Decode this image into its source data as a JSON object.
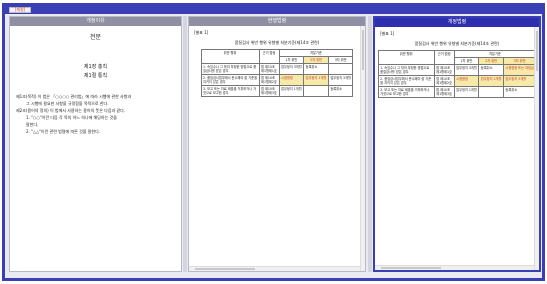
{
  "app": {
    "tab_label": "[개정]"
  },
  "panes": [
    {
      "header": "개정이유"
    },
    {
      "header": "현행법령"
    },
    {
      "header": "개정법령"
    }
  ],
  "doc": {
    "title": "전문",
    "part": "제1장 총칙",
    "chapter": "제1절 통칙",
    "lines": [
      "제1조(목적) 이 법은 「○○○○ 관리법」에 따라 시행에 관한 사항과",
      "그 시행에 필요한 사항을 규정함을 목적으로 한다.",
      "제2조(용어의 정의) 이 법에서 사용하는 용어의 뜻은 다음과 같다.",
      "1. \"○○\"이란 다음 각 목의 어느 하나에 해당하는 것을",
      "말한다.",
      "2. \"△△\"이란 관련 법령에 따른 것을 말한다."
    ]
  },
  "form": {
    "note": "[별표 1]",
    "title": "품질검사 위반 행위 유형별 처분기준(제14조 관련)",
    "col_headers": [
      "위반 행위",
      "근거 법령",
      "처분기준",
      "1차 위반",
      "2차 위반",
      "3차 위반"
    ],
    "current_rows": [
      {
        "act": "1. 속임수나 그 밖의 부정한 방법으로 품질검사를 받은 경우",
        "law": "법 제10조 제1항제1호",
        "c1": "업무정지 3개월",
        "c2": "등록취소",
        "c3": "",
        "hl": false
      },
      {
        "act": "2. 품질검사업무에서 준수해야 할 기준을 지키지 않은 경우",
        "law": "법 제10조 제1항제2호",
        "c1": "시정명령",
        "c2": "업무정지 1개월",
        "c3": "업무정지 3개월",
        "hl": true
      },
      {
        "act": "3. 보고 또는 자료 제출을 거부하거나 거짓으로 보고한 경우",
        "law": "법 제10조 제1항제3호",
        "c1": "업무정지 1개월",
        "c2": "",
        "c3": "등록취소",
        "hl": false
      }
    ],
    "revised_rows": [
      {
        "act": "1. 속임수나 그 밖의 부정한 방법으로 품질검사를 받은 경우",
        "law": "법 제10조 제1항제1호",
        "c1": "업무정지 3개월",
        "c2": "등록취소",
        "c3": "시정명령 또는 과징금",
        "hl": true
      },
      {
        "act": "2. 품질검사업무에서 준수해야 할 기준을 지키지 않은 경우",
        "law": "법 제10조 제1항제2호",
        "c1": "시정명령",
        "c2": "업무정지 1개월",
        "c3": "업무정지 3개월",
        "hl": true
      },
      {
        "act": "3. 보고 또는 자료 제출을 거부하거나 거짓으로 보고한 경우",
        "law": "법 제10조 제1항제3호",
        "c1": "업무정지 1개월",
        "c2": "",
        "c3": "등록취소",
        "hl": false
      }
    ]
  }
}
